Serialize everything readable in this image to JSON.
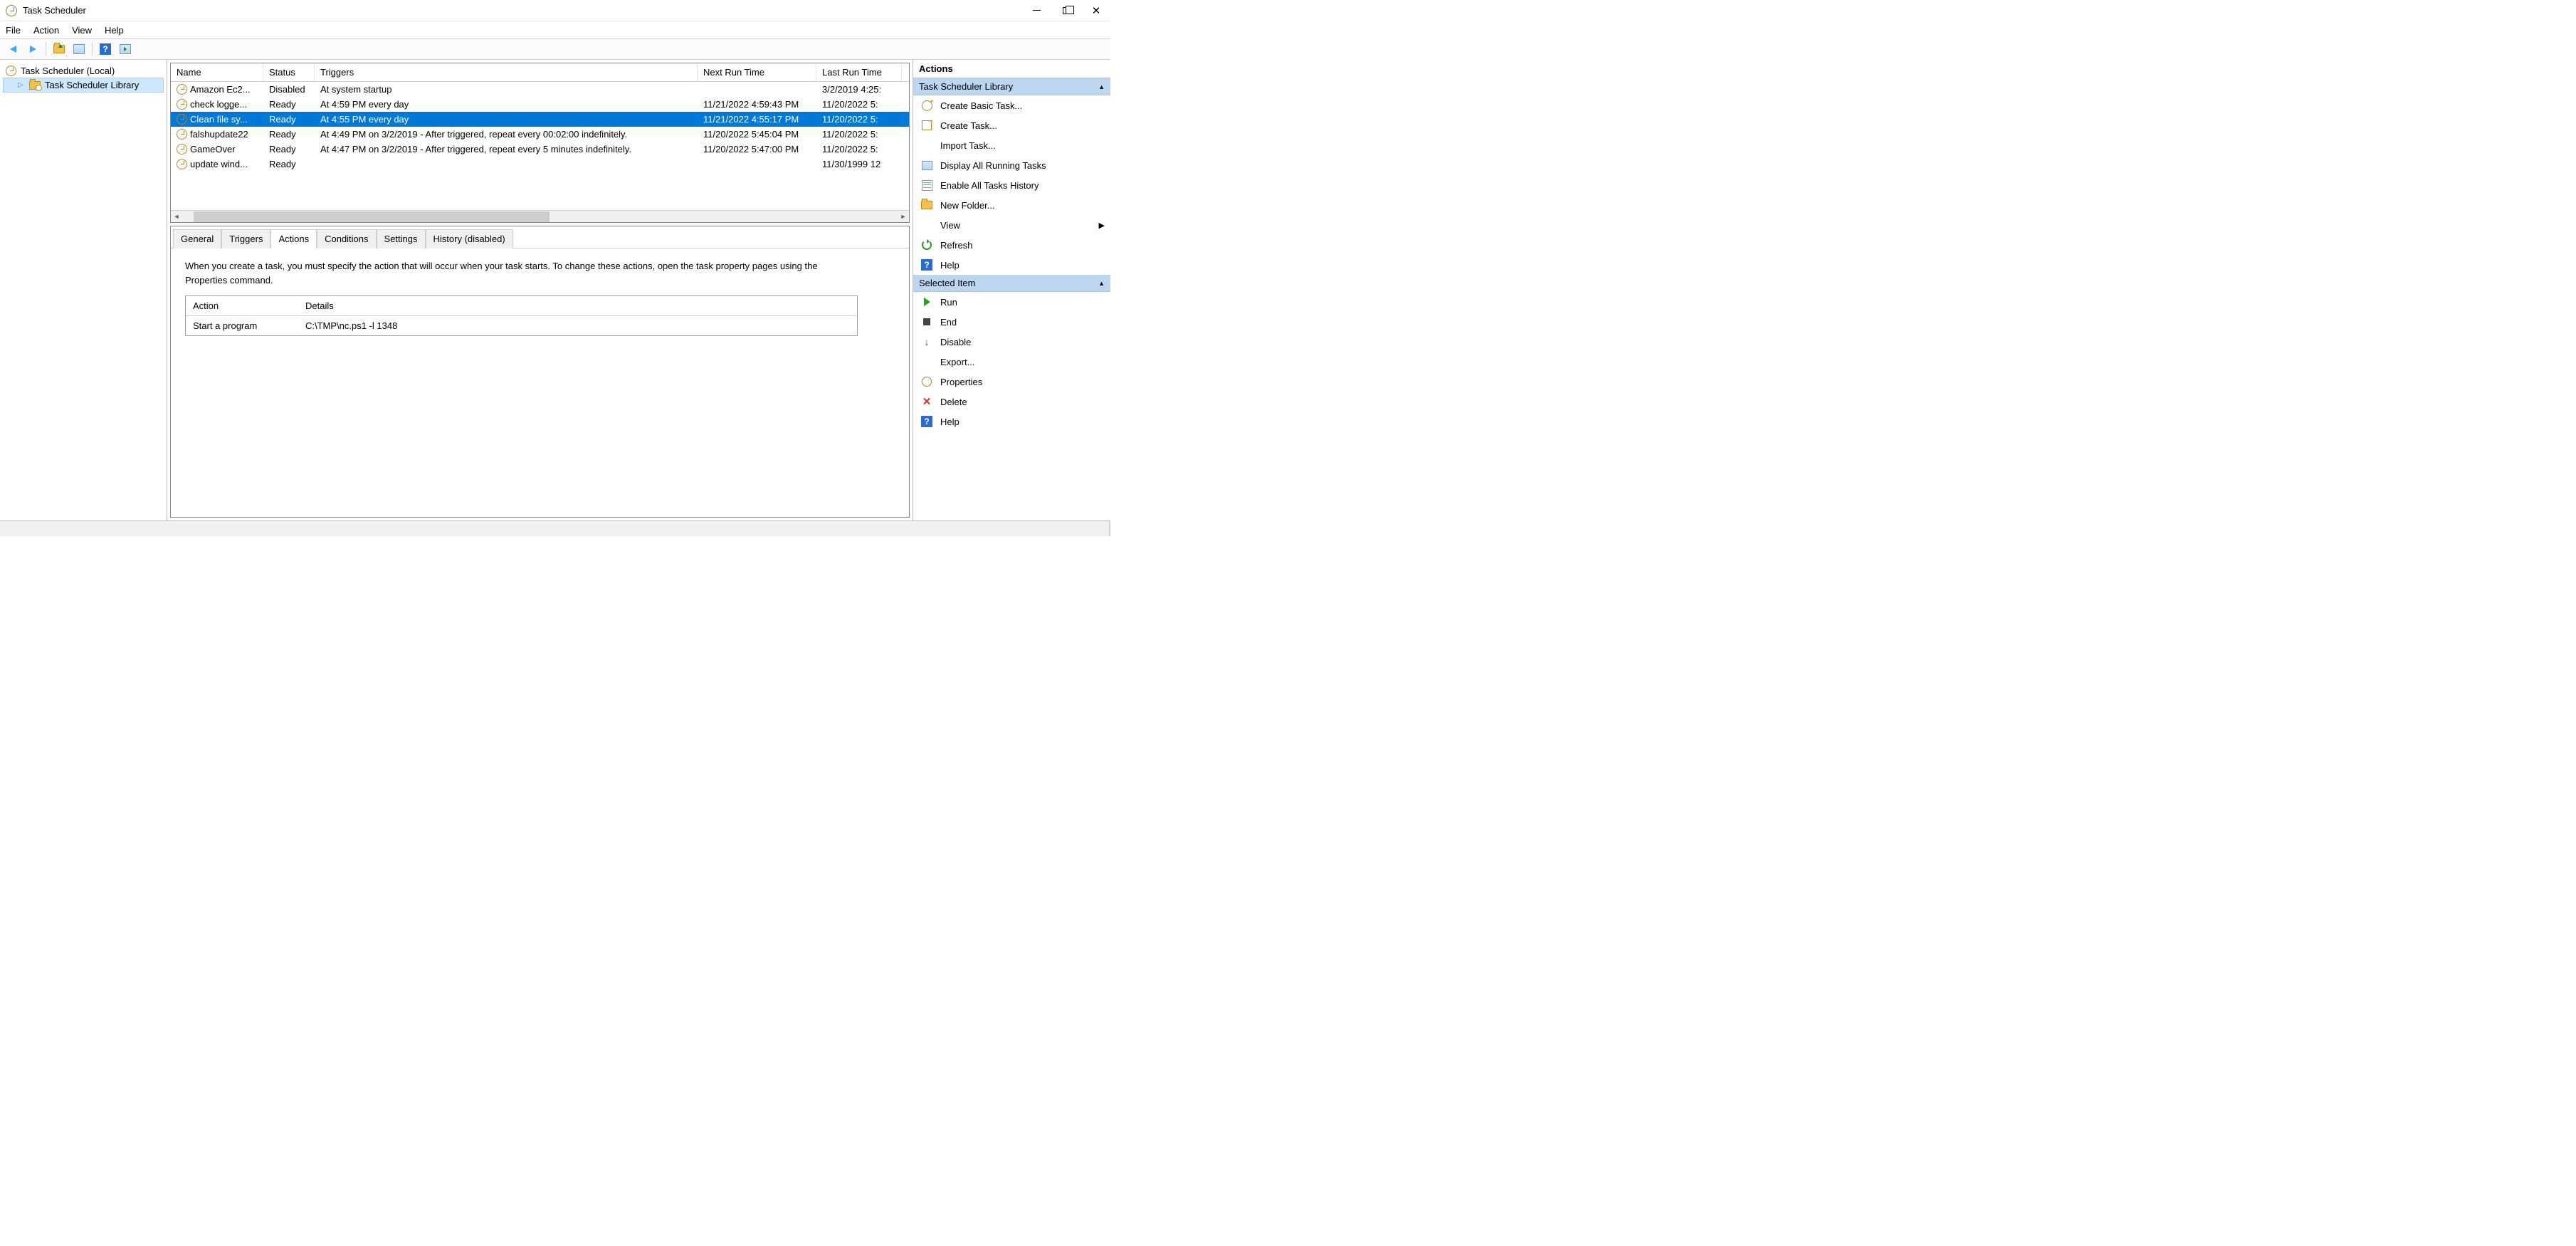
{
  "window": {
    "title": "Task Scheduler"
  },
  "menu": {
    "file": "File",
    "action": "Action",
    "view": "View",
    "help": "Help"
  },
  "tree": {
    "root": "Task Scheduler (Local)",
    "library": "Task Scheduler Library"
  },
  "task_table": {
    "columns": {
      "name": "Name",
      "status": "Status",
      "triggers": "Triggers",
      "next_run": "Next Run Time",
      "last_run": "Last Run Time"
    },
    "rows": [
      {
        "name": "Amazon Ec2...",
        "status": "Disabled",
        "triggers": "At system startup",
        "next_run": "",
        "last_run": "3/2/2019 4:25:"
      },
      {
        "name": "check logge...",
        "status": "Ready",
        "triggers": "At 4:59 PM every day",
        "next_run": "11/21/2022 4:59:43 PM",
        "last_run": "11/20/2022 5:"
      },
      {
        "name": "Clean file sy...",
        "status": "Ready",
        "triggers": "At 4:55 PM every day",
        "next_run": "11/21/2022 4:55:17 PM",
        "last_run": "11/20/2022 5:"
      },
      {
        "name": "falshupdate22",
        "status": "Ready",
        "triggers": "At 4:49 PM on 3/2/2019 - After triggered, repeat every 00:02:00 indefinitely.",
        "next_run": "11/20/2022 5:45:04 PM",
        "last_run": "11/20/2022 5:"
      },
      {
        "name": "GameOver",
        "status": "Ready",
        "triggers": "At 4:47 PM on 3/2/2019 - After triggered, repeat every 5 minutes indefinitely.",
        "next_run": "11/20/2022 5:47:00 PM",
        "last_run": "11/20/2022 5:"
      },
      {
        "name": "update wind...",
        "status": "Ready",
        "triggers": "",
        "next_run": "",
        "last_run": "11/30/1999 12"
      }
    ],
    "selected_index": 2
  },
  "tabs": {
    "general": "General",
    "triggers": "Triggers",
    "actions": "Actions",
    "conditions": "Conditions",
    "settings": "Settings",
    "history": "History (disabled)",
    "active": "actions"
  },
  "actions_tab": {
    "desc": "When you create a task, you must specify the action that will occur when your task starts.  To change these actions, open the task property pages using the Properties command.",
    "columns": {
      "action": "Action",
      "details": "Details"
    },
    "rows": [
      {
        "action": "Start a program",
        "details": "C:\\TMP\\nc.ps1 -l 1348"
      }
    ]
  },
  "actions_pane": {
    "title": "Actions",
    "section1": "Task Scheduler Library",
    "items1": {
      "create_basic": "Create Basic Task...",
      "create_task": "Create Task...",
      "import": "Import Task...",
      "display_running": "Display All Running Tasks",
      "enable_history": "Enable All Tasks History",
      "new_folder": "New Folder...",
      "view": "View",
      "refresh": "Refresh",
      "help": "Help"
    },
    "section2": "Selected Item",
    "items2": {
      "run": "Run",
      "end": "End",
      "disable": "Disable",
      "export": "Export...",
      "properties": "Properties",
      "delete": "Delete",
      "help2": "Help"
    }
  }
}
